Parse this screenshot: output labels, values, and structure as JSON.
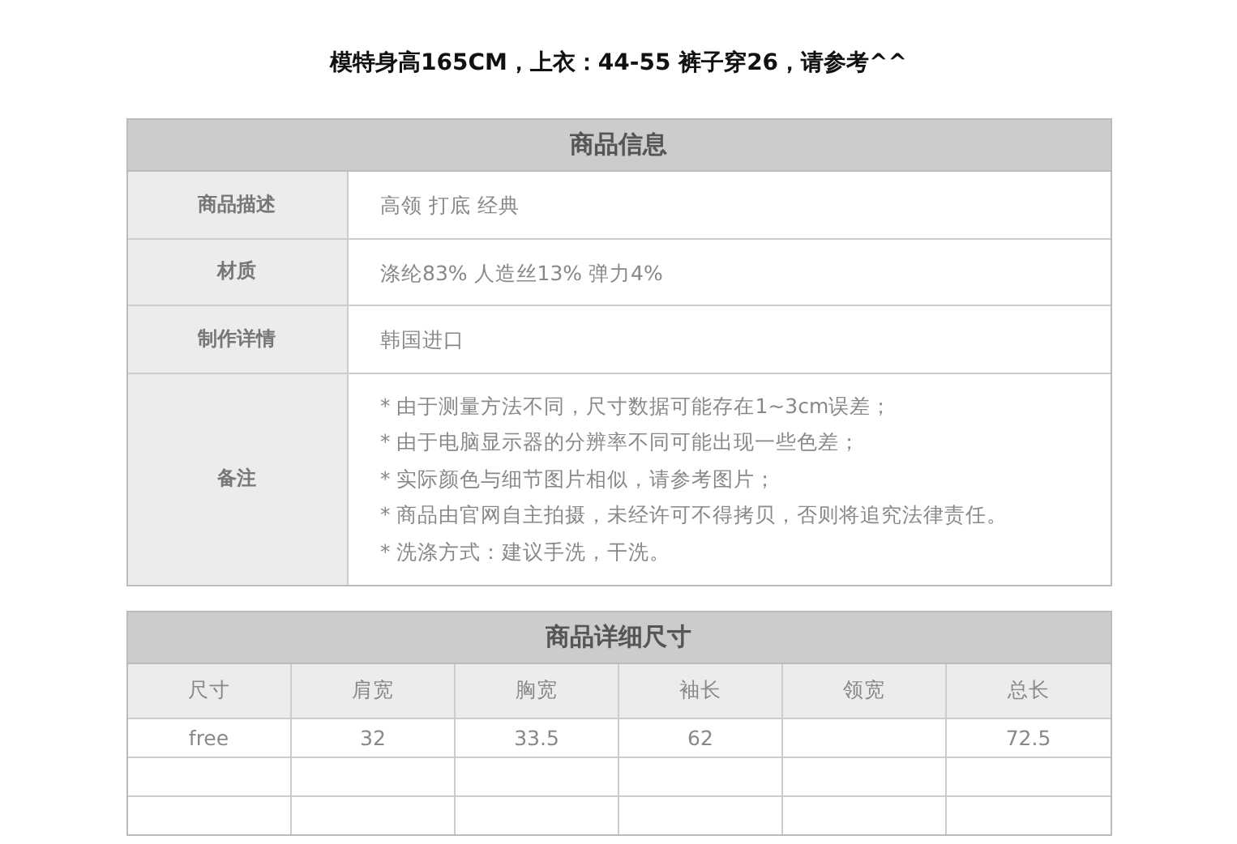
{
  "headline": "模特身高165CM，上衣：44-55 裤子穿26，请参考^^",
  "info_table": {
    "title": "商品信息",
    "rows": [
      {
        "label": "商品描述",
        "lines": [
          "高领 打底 经典"
        ]
      },
      {
        "label": "材质",
        "lines": [
          "涤纶83% 人造丝13% 弹力4%"
        ]
      },
      {
        "label": "制作详情",
        "lines": [
          "韩国进口"
        ]
      },
      {
        "label": "备注",
        "lines": [
          "* 由于测量方法不同，尺寸数据可能存在1~3cm误差；",
          "* 由于电脑显示器的分辨率不同可能出现一些色差；",
          "* 实际颜色与细节图片相似，请参考图片；",
          "* 商品由官网自主拍摄，未经许可不得拷贝，否则将追究法律责任。",
          "* 洗涤方式：建议手洗，干洗。"
        ]
      }
    ]
  },
  "size_table": {
    "title": "商品详细尺寸",
    "columns": [
      "尺寸",
      "肩宽",
      "胸宽",
      "袖长",
      "领宽",
      "总长"
    ],
    "rows": [
      {
        "cells": [
          "free",
          "32",
          "33.5",
          "62",
          null,
          "72.5"
        ]
      }
    ]
  }
}
